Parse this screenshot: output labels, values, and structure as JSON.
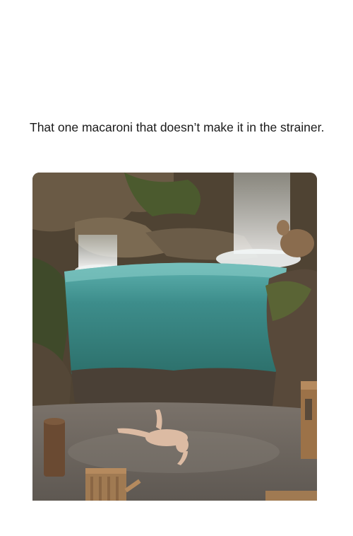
{
  "post": {
    "caption": "That one macaroni that doesn’t make it in the strainer."
  },
  "photo": {
    "subject": "person lying face-down on wet floor in front of an aquarium with waterfalls",
    "palette": {
      "rock": "#5a4a38",
      "water": "#3f8f8c",
      "floor": "#6e6761",
      "skin": "#d9b8a0"
    }
  }
}
